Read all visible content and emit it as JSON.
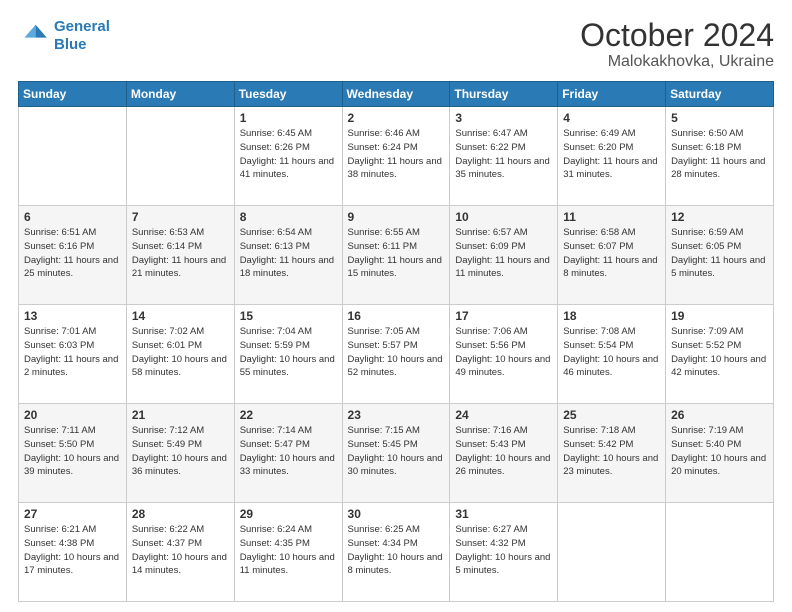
{
  "header": {
    "logo_line1": "General",
    "logo_line2": "Blue",
    "title": "October 2024",
    "subtitle": "Malokakhovka, Ukraine"
  },
  "weekdays": [
    "Sunday",
    "Monday",
    "Tuesday",
    "Wednesday",
    "Thursday",
    "Friday",
    "Saturday"
  ],
  "weeks": [
    [
      {
        "day": "",
        "info": ""
      },
      {
        "day": "",
        "info": ""
      },
      {
        "day": "1",
        "info": "Sunrise: 6:45 AM\nSunset: 6:26 PM\nDaylight: 11 hours and 41 minutes."
      },
      {
        "day": "2",
        "info": "Sunrise: 6:46 AM\nSunset: 6:24 PM\nDaylight: 11 hours and 38 minutes."
      },
      {
        "day": "3",
        "info": "Sunrise: 6:47 AM\nSunset: 6:22 PM\nDaylight: 11 hours and 35 minutes."
      },
      {
        "day": "4",
        "info": "Sunrise: 6:49 AM\nSunset: 6:20 PM\nDaylight: 11 hours and 31 minutes."
      },
      {
        "day": "5",
        "info": "Sunrise: 6:50 AM\nSunset: 6:18 PM\nDaylight: 11 hours and 28 minutes."
      }
    ],
    [
      {
        "day": "6",
        "info": "Sunrise: 6:51 AM\nSunset: 6:16 PM\nDaylight: 11 hours and 25 minutes."
      },
      {
        "day": "7",
        "info": "Sunrise: 6:53 AM\nSunset: 6:14 PM\nDaylight: 11 hours and 21 minutes."
      },
      {
        "day": "8",
        "info": "Sunrise: 6:54 AM\nSunset: 6:13 PM\nDaylight: 11 hours and 18 minutes."
      },
      {
        "day": "9",
        "info": "Sunrise: 6:55 AM\nSunset: 6:11 PM\nDaylight: 11 hours and 15 minutes."
      },
      {
        "day": "10",
        "info": "Sunrise: 6:57 AM\nSunset: 6:09 PM\nDaylight: 11 hours and 11 minutes."
      },
      {
        "day": "11",
        "info": "Sunrise: 6:58 AM\nSunset: 6:07 PM\nDaylight: 11 hours and 8 minutes."
      },
      {
        "day": "12",
        "info": "Sunrise: 6:59 AM\nSunset: 6:05 PM\nDaylight: 11 hours and 5 minutes."
      }
    ],
    [
      {
        "day": "13",
        "info": "Sunrise: 7:01 AM\nSunset: 6:03 PM\nDaylight: 11 hours and 2 minutes."
      },
      {
        "day": "14",
        "info": "Sunrise: 7:02 AM\nSunset: 6:01 PM\nDaylight: 10 hours and 58 minutes."
      },
      {
        "day": "15",
        "info": "Sunrise: 7:04 AM\nSunset: 5:59 PM\nDaylight: 10 hours and 55 minutes."
      },
      {
        "day": "16",
        "info": "Sunrise: 7:05 AM\nSunset: 5:57 PM\nDaylight: 10 hours and 52 minutes."
      },
      {
        "day": "17",
        "info": "Sunrise: 7:06 AM\nSunset: 5:56 PM\nDaylight: 10 hours and 49 minutes."
      },
      {
        "day": "18",
        "info": "Sunrise: 7:08 AM\nSunset: 5:54 PM\nDaylight: 10 hours and 46 minutes."
      },
      {
        "day": "19",
        "info": "Sunrise: 7:09 AM\nSunset: 5:52 PM\nDaylight: 10 hours and 42 minutes."
      }
    ],
    [
      {
        "day": "20",
        "info": "Sunrise: 7:11 AM\nSunset: 5:50 PM\nDaylight: 10 hours and 39 minutes."
      },
      {
        "day": "21",
        "info": "Sunrise: 7:12 AM\nSunset: 5:49 PM\nDaylight: 10 hours and 36 minutes."
      },
      {
        "day": "22",
        "info": "Sunrise: 7:14 AM\nSunset: 5:47 PM\nDaylight: 10 hours and 33 minutes."
      },
      {
        "day": "23",
        "info": "Sunrise: 7:15 AM\nSunset: 5:45 PM\nDaylight: 10 hours and 30 minutes."
      },
      {
        "day": "24",
        "info": "Sunrise: 7:16 AM\nSunset: 5:43 PM\nDaylight: 10 hours and 26 minutes."
      },
      {
        "day": "25",
        "info": "Sunrise: 7:18 AM\nSunset: 5:42 PM\nDaylight: 10 hours and 23 minutes."
      },
      {
        "day": "26",
        "info": "Sunrise: 7:19 AM\nSunset: 5:40 PM\nDaylight: 10 hours and 20 minutes."
      }
    ],
    [
      {
        "day": "27",
        "info": "Sunrise: 6:21 AM\nSunset: 4:38 PM\nDaylight: 10 hours and 17 minutes."
      },
      {
        "day": "28",
        "info": "Sunrise: 6:22 AM\nSunset: 4:37 PM\nDaylight: 10 hours and 14 minutes."
      },
      {
        "day": "29",
        "info": "Sunrise: 6:24 AM\nSunset: 4:35 PM\nDaylight: 10 hours and 11 minutes."
      },
      {
        "day": "30",
        "info": "Sunrise: 6:25 AM\nSunset: 4:34 PM\nDaylight: 10 hours and 8 minutes."
      },
      {
        "day": "31",
        "info": "Sunrise: 6:27 AM\nSunset: 4:32 PM\nDaylight: 10 hours and 5 minutes."
      },
      {
        "day": "",
        "info": ""
      },
      {
        "day": "",
        "info": ""
      }
    ]
  ]
}
